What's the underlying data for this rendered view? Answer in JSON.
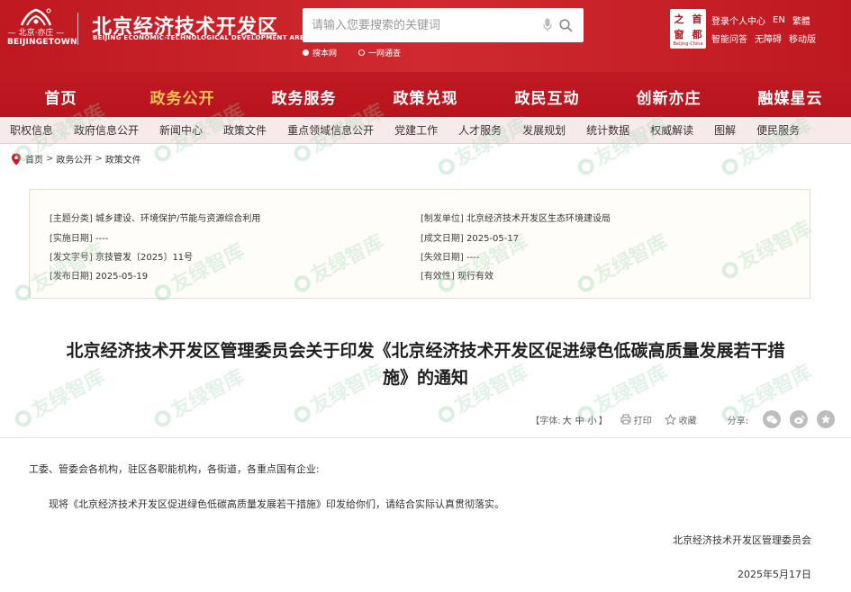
{
  "header": {
    "logo_city": "— 北京·亦庄 —",
    "logo_en": "BEIJINGETOWN",
    "site_title": "北京经济技术开发区",
    "site_subtitle": "BEIJING ECONOMIC-TECHNOLOGICAL DEVELOPMENT AREA",
    "search_placeholder": "请输入您要搜索的关键词",
    "scope_options": [
      "搜本网",
      "一网通查"
    ],
    "badge_glyphs": [
      "之",
      "首",
      "窗",
      "都"
    ],
    "badge_caption": "Beijing-China",
    "top_links_row1": [
      "登录个人中心",
      "EN",
      "繁體"
    ],
    "top_links_row2": [
      "智能问答",
      "无障碍",
      "移动版"
    ]
  },
  "main_nav": [
    "首页",
    "政务公开",
    "政务服务",
    "政策兑现",
    "政民互动",
    "创新亦庄",
    "融媒星云"
  ],
  "main_nav_active": "政务公开",
  "sub_nav": [
    "职权信息",
    "政府信息公开",
    "新闻中心",
    "政策文件",
    "重点领域信息公开",
    "党建工作",
    "人才服务",
    "发展规划",
    "统计数据",
    "权威解读",
    "图解",
    "便民服务"
  ],
  "breadcrumb": [
    "首页",
    "政务公开",
    "政策文件"
  ],
  "info": {
    "category_key": "[主题分类]",
    "category_val": "城乡建设、环境保护/节能与资源综合利用",
    "issuer_key": "[制发单位]",
    "issuer_val": "北京经济技术开发区生态环境建设局",
    "impl_key": "[实施日期]",
    "impl_val": "----",
    "made_key": "[成文日期]",
    "made_val": "2025-05-17",
    "docno_key": "[发文字号]",
    "docno_val": "京技管发〔2025〕11号",
    "expire_key": "[失效日期]",
    "expire_val": "----",
    "pub_key": "[发布日期]",
    "pub_val": "2025-05-19",
    "valid_key": "[有效性]",
    "valid_val": "现行有效"
  },
  "doc_title_line1": "北京经济技术开发区管理委员会关于印发《北京经济技术开发区促进绿色低碳高质量发展若干措",
  "doc_title_line2": "施》的通知",
  "toolbar": {
    "font_label": "【字体:",
    "font_large": "大",
    "font_medium": "中",
    "font_small": "小",
    "font_close": "】",
    "print": "打印",
    "favorite": "收藏",
    "share": "分享:"
  },
  "body": {
    "salutation": "工委、管委会各机构，驻区各职能机构，各街道，各重点国有企业:",
    "paragraph": "现将《北京经济技术开发区促进绿色低碳高质量发展若干措施》印发给你们，请结合实际认真贯彻落实。",
    "signature": "北京经济技术开发区管理委员会",
    "date": "2025年5月17日"
  },
  "watermark_text": "友绿智库",
  "colors": {
    "header_red": "#c41b24",
    "active_nav": "#f6c453",
    "subnav_bg": "#f7eaea",
    "watermark_green": "#96d2aa"
  }
}
